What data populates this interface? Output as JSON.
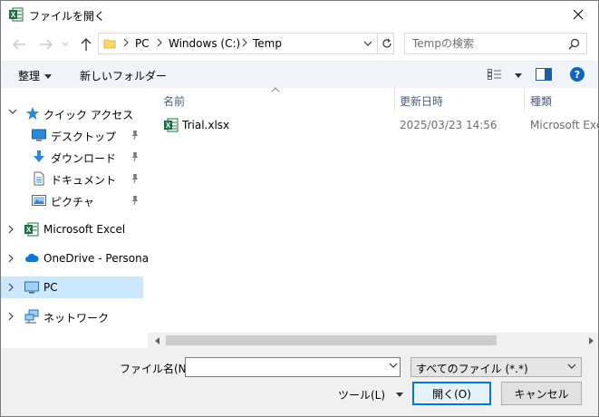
{
  "window": {
    "title": "ファイルを開く"
  },
  "address": {
    "crumbs": [
      "PC",
      "Windows (C:)",
      "Temp"
    ]
  },
  "search": {
    "placeholder": "Tempの検索"
  },
  "toolbar": {
    "organize": "整理",
    "new_folder": "新しいフォルダー",
    "help": "?"
  },
  "sidebar": {
    "quick_access": "クイック アクセス",
    "items": [
      {
        "label": "デスクトップ"
      },
      {
        "label": "ダウンロード"
      },
      {
        "label": "ドキュメント"
      },
      {
        "label": "ピクチャ"
      }
    ],
    "excel": "Microsoft Excel",
    "onedrive": "OneDrive - Personal",
    "pc": "PC",
    "network": "ネットワーク"
  },
  "columns": {
    "name": "名前",
    "modified": "更新日時",
    "type": "種類"
  },
  "files": [
    {
      "name": "Trial.xlsx",
      "modified": "2025/03/23 14:56",
      "type": "Microsoft Excel"
    }
  ],
  "footer": {
    "filename_label": "ファイル名(N):",
    "filename_value": "",
    "filetype": "すべてのファイル (*.*)",
    "tools": "ツール(L)",
    "open": "開く(O)",
    "cancel": "キャンセル"
  },
  "colors": {
    "accent": "#0078d7",
    "selected": "#cce8ff",
    "excel": "#1d6f42",
    "help": "#0f65c1"
  }
}
